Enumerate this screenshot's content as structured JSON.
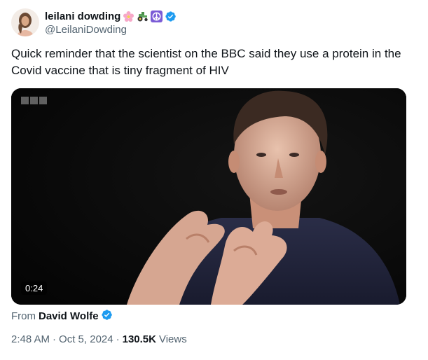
{
  "author": {
    "display_name": "leilani dowding",
    "handle": "@LeilaniDowding",
    "emojis": [
      "cherry-blossom-icon",
      "tractor-icon",
      "peace-symbol-icon"
    ],
    "verified": true
  },
  "tweet": {
    "text": "Quick reminder that the scientist on the BBC said they use a protein in the Covid vaccine that is tiny fragment of HIV"
  },
  "media": {
    "type": "video",
    "duration": "0:24",
    "watermark": "BBC"
  },
  "source": {
    "prefix": "From",
    "author": "David Wolfe",
    "verified": true
  },
  "meta": {
    "time": "2:48 AM",
    "date": "Oct 5, 2024",
    "views_count": "130.5K",
    "views_label": "Views"
  },
  "colors": {
    "text": "#0f1419",
    "secondary": "#536471",
    "verified": "#1d9bf0",
    "peace": "#7b5cd6"
  }
}
